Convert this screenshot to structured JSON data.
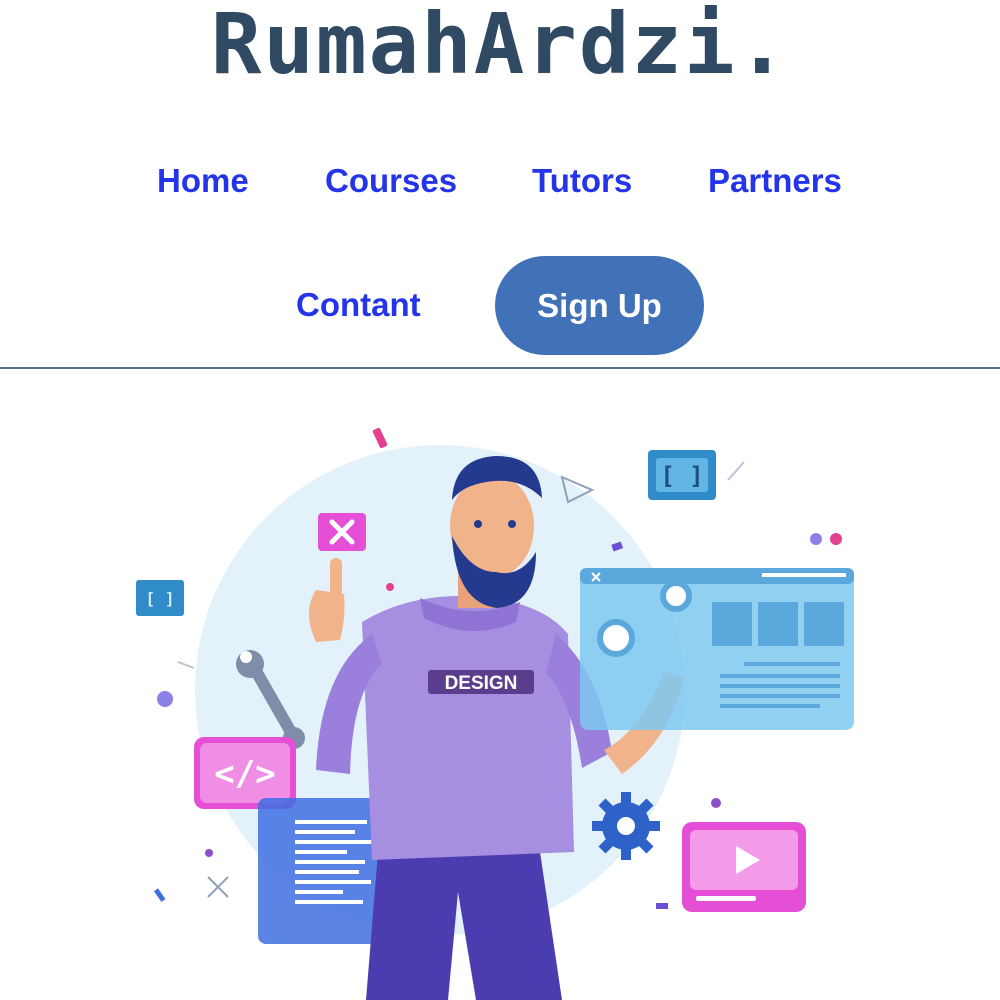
{
  "brand": {
    "name": "RumahArdzi."
  },
  "nav": {
    "items": [
      {
        "label": "Home"
      },
      {
        "label": "Courses"
      },
      {
        "label": "Tutors"
      },
      {
        "label": "Partners"
      },
      {
        "label": "Contant"
      }
    ],
    "signup_label": "Sign Up"
  },
  "hero": {
    "shirt_text": "DESIGN",
    "code_tag": "</>",
    "bracket_tag": "[ ]",
    "colors": {
      "circle": "#e3f1fb",
      "shirt": "#a68fe0",
      "panel": "#7fc8f0",
      "pink": "#e54fd6",
      "code_panel": "#3f6fe0"
    }
  },
  "colors": {
    "brand_text": "#2f4a62",
    "nav_link": "#2434e8",
    "signup_bg": "#4172b7",
    "divider": "#5b7083"
  }
}
